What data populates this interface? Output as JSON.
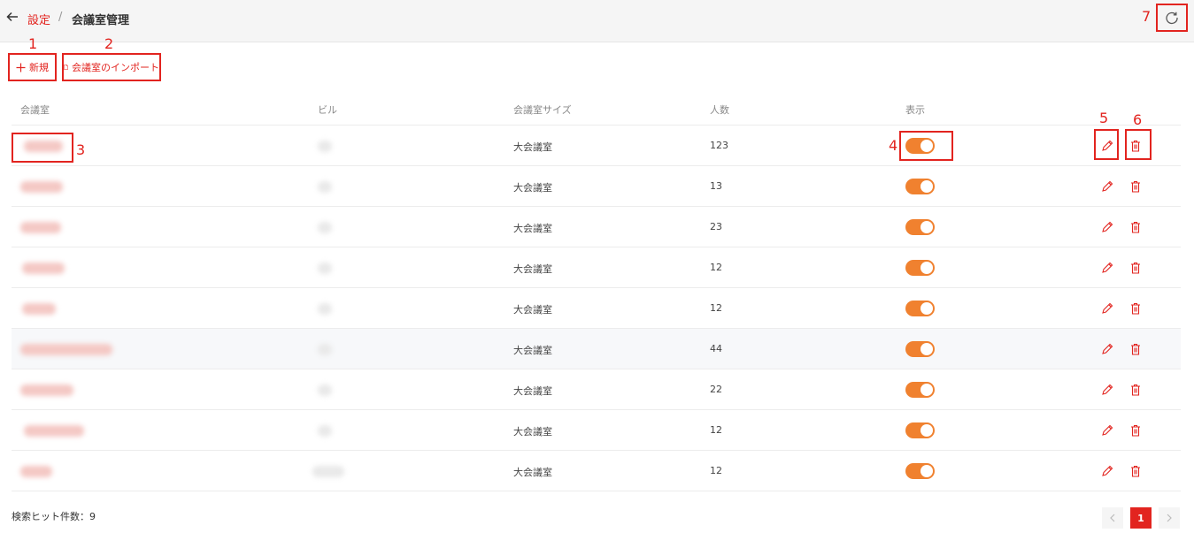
{
  "breadcrumb": {
    "parent": "設定",
    "separator": "/",
    "current": "会議室管理"
  },
  "toolbar": {
    "new_label": "新規",
    "import_label": "会議室のインポート"
  },
  "table": {
    "headers": {
      "room": "会議室",
      "building": "ビル",
      "size": "会議室サイズ",
      "people": "人数",
      "display": "表示"
    },
    "rows": [
      {
        "size": "大会議室",
        "people": "123",
        "display_on": true
      },
      {
        "size": "大会議室",
        "people": "13",
        "display_on": true
      },
      {
        "size": "大会議室",
        "people": "23",
        "display_on": true
      },
      {
        "size": "大会議室",
        "people": "12",
        "display_on": true
      },
      {
        "size": "大会議室",
        "people": "12",
        "display_on": true
      },
      {
        "size": "大会議室",
        "people": "44",
        "display_on": true
      },
      {
        "size": "大会議室",
        "people": "22",
        "display_on": true
      },
      {
        "size": "大会議室",
        "people": "12",
        "display_on": true
      },
      {
        "size": "大会議室",
        "people": "12",
        "display_on": true
      }
    ]
  },
  "footer": {
    "hits_label": "検索ヒット件数：9"
  },
  "pagination": {
    "current_page": "1",
    "prev_icon": "chevron-left-icon",
    "next_icon": "chevron-right-icon"
  },
  "annotations": {
    "n1": "1",
    "n2": "2",
    "n3": "3",
    "n4": "4",
    "n5": "5",
    "n6": "6",
    "n7": "7"
  },
  "colors": {
    "accent": "#e2241f",
    "toggle_on": "#f0812f"
  }
}
